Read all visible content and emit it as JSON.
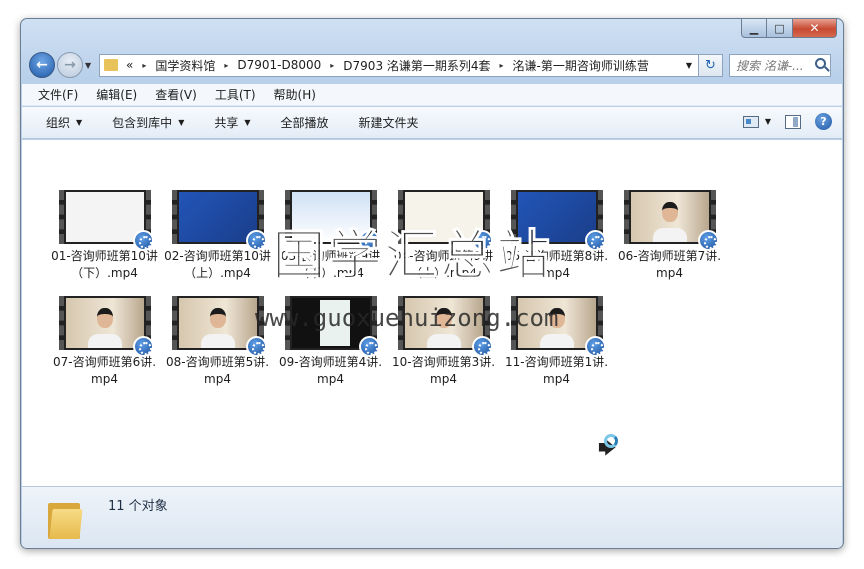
{
  "window": {
    "controls": {
      "minimize": "▁",
      "maximize": "□",
      "close": "✕"
    }
  },
  "nav": {
    "back": "←",
    "forward": "→",
    "history_drop": "▼",
    "breadcrumb_prefix": "«",
    "breadcrumbs": [
      "国学资料馆",
      "D7901-D8000",
      "D7903 洺谦第一期系列4套",
      "洺谦-第一期咨询师训练营"
    ],
    "breadcrumb_separator": "▸",
    "address_drop": "▼",
    "refresh": "↻",
    "search_placeholder": "搜索 洺谦-..."
  },
  "menubar": [
    "文件(F)",
    "编辑(E)",
    "查看(V)",
    "工具(T)",
    "帮助(H)"
  ],
  "toolbar": {
    "organize": "组织",
    "include_library": "包含到库中",
    "share": "共享",
    "play_all": "全部播放",
    "new_folder": "新建文件夹",
    "caret": "▼",
    "help": "?"
  },
  "files": [
    {
      "name": "01-咨询师班第10讲（下）.mp4",
      "thumb": "white"
    },
    {
      "name": "02-咨询师班第10讲（上）.mp4",
      "thumb": "blue"
    },
    {
      "name": "03-咨询师班第9讲（下）.mp4",
      "thumb": "slide"
    },
    {
      "name": "04-咨询师班第9讲（上）.mp4",
      "thumb": "cream"
    },
    {
      "name": "05-咨询师班第8讲.mp4",
      "thumb": "blue"
    },
    {
      "name": "06-咨询师班第7讲.mp4",
      "thumb": "person"
    },
    {
      "name": "07-咨询师班第6讲.mp4",
      "thumb": "person"
    },
    {
      "name": "08-咨询师班第5讲.mp4",
      "thumb": "person"
    },
    {
      "name": "09-咨询师班第4讲.mp4",
      "thumb": "app"
    },
    {
      "name": "10-咨询师班第3讲.mp4",
      "thumb": "person"
    },
    {
      "name": "11-咨询师班第1讲.mp4",
      "thumb": "person"
    }
  ],
  "watermark": {
    "cn": "国学汇总站",
    "url": "www.guoxuehuizong.com"
  },
  "status": {
    "count_text": "11 个对象"
  }
}
